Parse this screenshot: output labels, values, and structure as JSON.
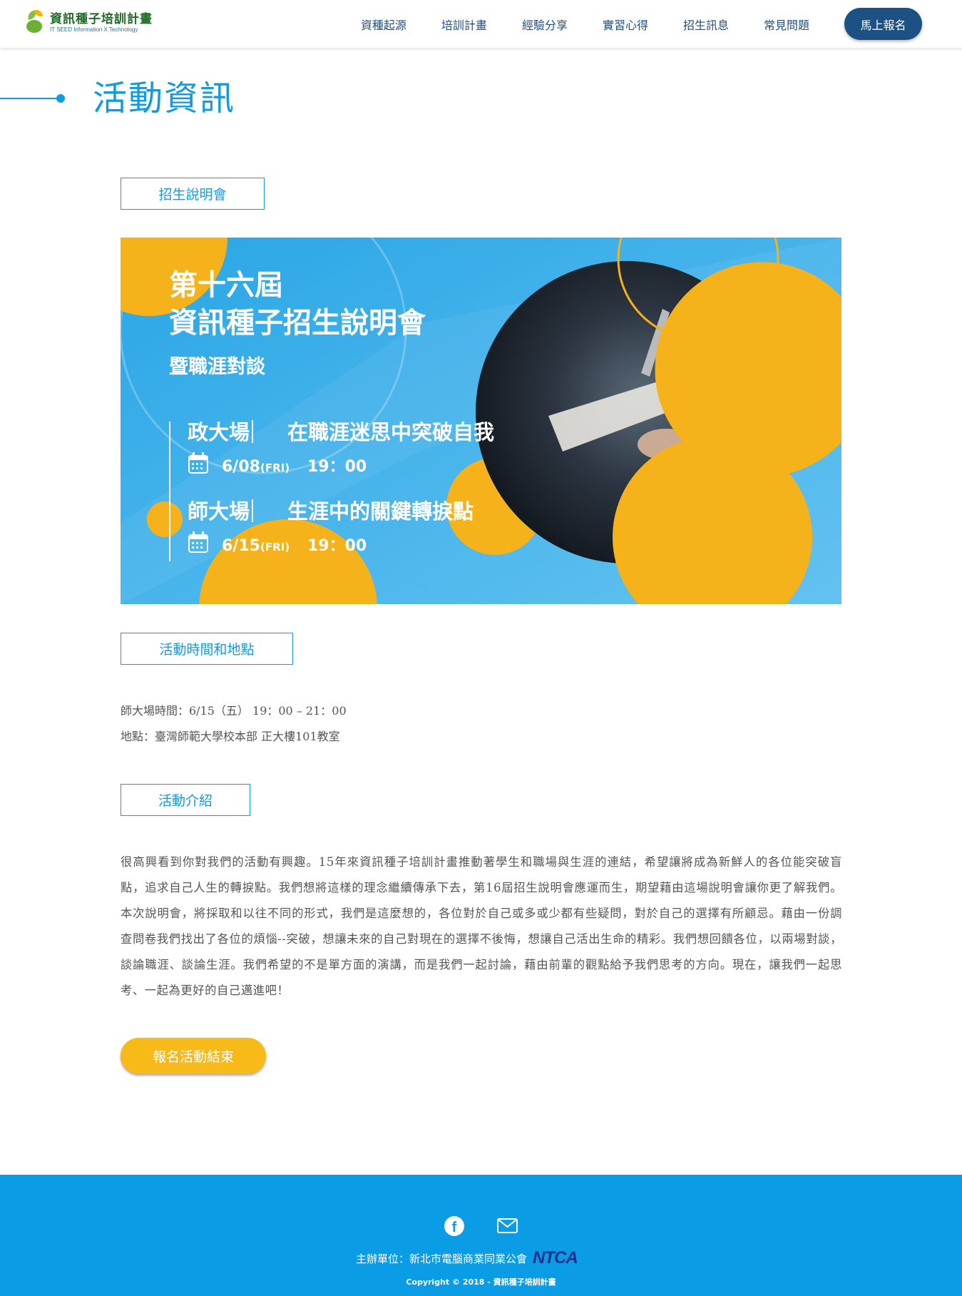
{
  "header": {
    "logo_title": "資訊種子培訓計畫",
    "logo_subtitle": "IT SEED  Information X Technology",
    "nav": [
      "資種起源",
      "培訓計畫",
      "經驗分享",
      "實習心得",
      "招生訊息",
      "常見問題"
    ],
    "cta_label": "馬上報名"
  },
  "page_title": "活動資訊",
  "sections": {
    "briefing_label": "招生說明會",
    "time_place_label": "活動時間和地點",
    "intro_label": "活動介紹"
  },
  "banner": {
    "title_line1": "第十六屆",
    "title_line2": "資訊種子招生說明會",
    "title_line3": "暨職涯對談",
    "session1_venue": "政大場",
    "session1_topic": "在職涯迷思中突破自我",
    "session1_date": "6/08",
    "session1_day": "(FRI)",
    "session1_time": "19：00",
    "session2_venue": "師大場",
    "session2_topic": "生涯中的關鍵轉捩點",
    "session2_date": "6/15",
    "session2_day": "(FRI)",
    "session2_time": "19：00"
  },
  "event_info": {
    "time_line": "師大場時間：6/15（五） 19：00 – 21：00",
    "place_line": "地點：臺灣師範大學校本部 正大樓101教室"
  },
  "intro_text": "很高興看到你對我們的活動有興趣。15年來資訊種子培訓計畫推動著學生和職場與生涯的連結，希望讓將成為新鮮人的各位能突破盲點，追求自己人生的轉捩點。我們想將這樣的理念繼續傳承下去，第16屆招生說明會應運而生，期望藉由這場說明會讓你更了解我們。本次說明會，將採取和以往不同的形式，我們是這麼想的，各位對於自己或多或少都有些疑問，對於自己的選擇有所顧忌。藉由一份調查問卷我們找出了各位的煩惱--突破，想讓未來的自己對現在的選擇不後悔，想讓自己活出生命的精彩。我們想回饋各位，以兩場對談，談論職涯、談論生涯。我們希望的不是單方面的演講，而是我們一起討論，藉由前輩的觀點給予我們思考的方向。現在，讓我們一起思考、一起為更好的自己邁進吧！",
  "ended_button": "報名活動結束",
  "footer": {
    "facebook_icon": "f",
    "organizer": "主辦單位：新北市電腦商業同業公會",
    "ntca_logo": "NTCA",
    "copyright": "Copyright © 2018 - 資訊種子培訓計畫"
  },
  "colors": {
    "primary": "#109be0",
    "nav": "#1f4f7f",
    "cta": "#1d5183",
    "accent": "#f7ba18",
    "footer": "#0a9de5"
  }
}
